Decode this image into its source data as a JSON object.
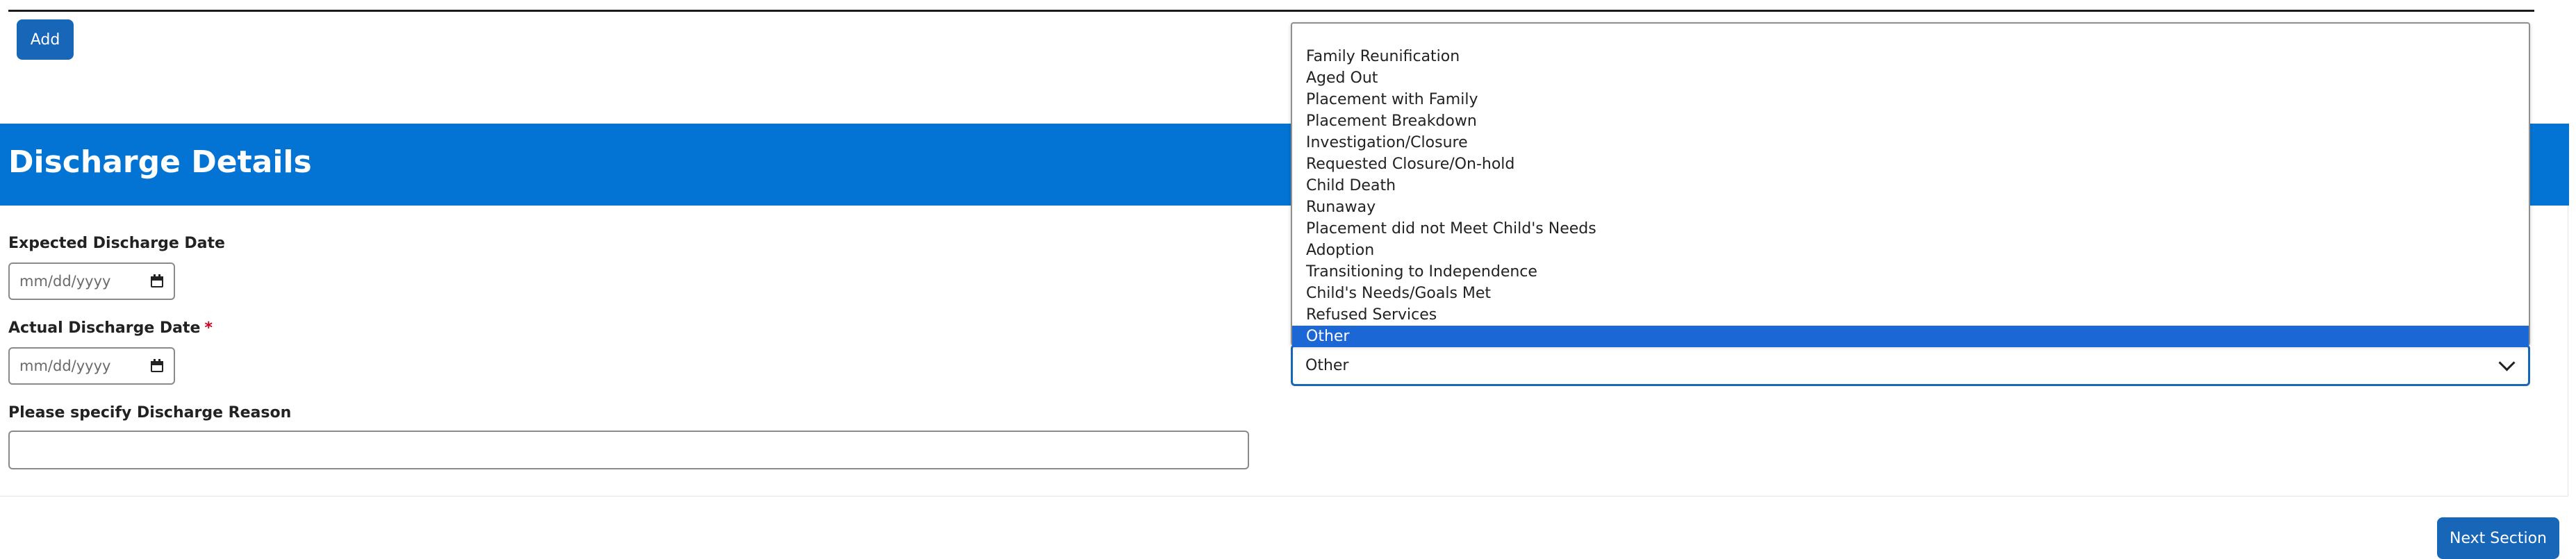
{
  "toolbar": {
    "add_label": "Add"
  },
  "section": {
    "title": "Discharge Details"
  },
  "fields": {
    "expected_discharge_date": {
      "label": "Expected Discharge Date",
      "placeholder": "mm/dd/yyyy"
    },
    "actual_discharge_date": {
      "label": "Actual Discharge Date",
      "required_marker": "*",
      "placeholder": "mm/dd/yyyy"
    },
    "discharge_reason_specify": {
      "label": "Please specify Discharge Reason",
      "value": ""
    }
  },
  "discharge_reason": {
    "selected": "Other",
    "options": [
      "Family Reunification",
      "Aged Out",
      "Placement with Family",
      "Placement Breakdown",
      "Investigation/Closure",
      "Requested Closure/On-hold",
      "Child Death",
      "Runaway",
      "Placement did not Meet Child's Needs",
      "Adoption",
      "Transitioning to Independence",
      "Child's Needs/Goals Met",
      "Refused Services",
      "Other"
    ]
  },
  "footer": {
    "next_label": "Next Section"
  },
  "colors": {
    "brand_blue": "#0474d4",
    "button_blue": "#1766b8",
    "selected_option": "#1b67d6",
    "required_red": "#d0021b"
  }
}
